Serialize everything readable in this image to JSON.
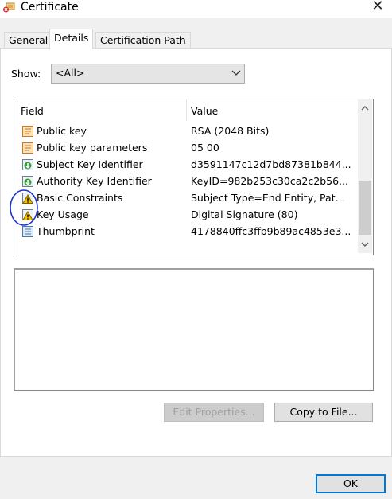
{
  "window": {
    "title": "Certificate",
    "close_glyph": "✕"
  },
  "tabs": [
    {
      "label": "General",
      "active": false
    },
    {
      "label": "Details",
      "active": true
    },
    {
      "label": "Certification Path",
      "active": false
    }
  ],
  "show": {
    "label": "Show:",
    "value": "<All>"
  },
  "grid": {
    "headers": {
      "field": "Field",
      "value": "Value"
    },
    "rows": [
      {
        "field": "Public key",
        "value": "RSA (2048 Bits)",
        "icon": "certificate-property-icon"
      },
      {
        "field": "Public key parameters",
        "value": "05 00",
        "icon": "certificate-property-icon"
      },
      {
        "field": "Subject Key Identifier",
        "value": "d3591147c12d7bd87381b844...",
        "icon": "extension-icon"
      },
      {
        "field": "Authority Key Identifier",
        "value": "KeyID=982b253c30ca2c2b56...",
        "icon": "extension-icon"
      },
      {
        "field": "Basic Constraints",
        "value": "Subject Type=End Entity, Pat...",
        "icon": "critical-extension-warning-icon"
      },
      {
        "field": "Key Usage",
        "value": "Digital Signature (80)",
        "icon": "critical-extension-warning-icon"
      },
      {
        "field": "Thumbprint",
        "value": "4178840ffc3ffb9b89ac4853e3...",
        "icon": "thumbprint-icon"
      }
    ]
  },
  "buttons": {
    "edit_properties": "Edit Properties...",
    "copy_to_file": "Copy to File...",
    "ok": "OK"
  },
  "colors": {
    "accent": "#0078d7",
    "annotation_circle": "#1a2fd6",
    "warning": "#f2c200"
  }
}
